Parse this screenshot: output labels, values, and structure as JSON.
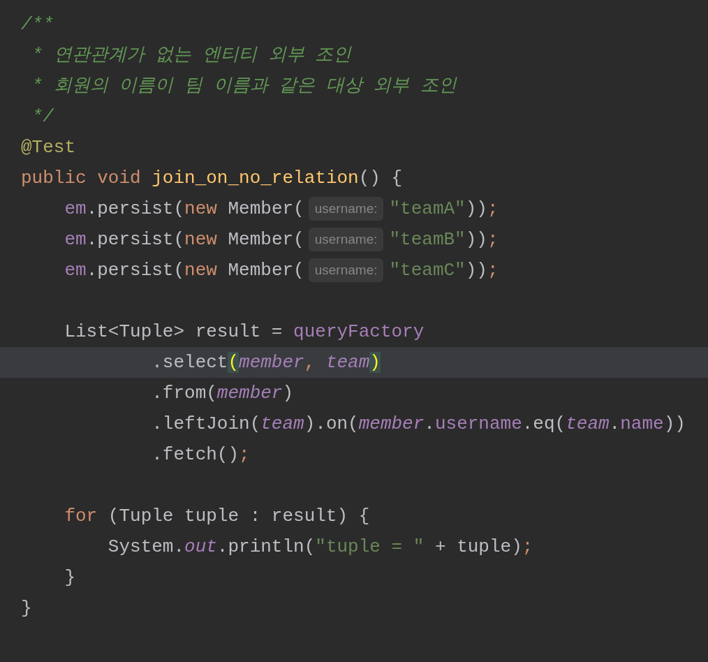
{
  "editor": {
    "lines": [
      {
        "current": false,
        "tokens": [
          {
            "kind": "comment",
            "text": "/**"
          }
        ]
      },
      {
        "current": false,
        "tokens": [
          {
            "kind": "comment",
            "text": " * 연관관계가 없는 엔티티 외부 조인"
          }
        ]
      },
      {
        "current": false,
        "tokens": [
          {
            "kind": "comment",
            "text": " * 회원의 이름이 팀 이름과 같은 대상 외부 조인"
          }
        ]
      },
      {
        "current": false,
        "tokens": [
          {
            "kind": "comment",
            "text": " */"
          }
        ]
      },
      {
        "current": false,
        "tokens": [
          {
            "kind": "annotation",
            "text": "@Test"
          }
        ]
      },
      {
        "current": false,
        "tokens": [
          {
            "kind": "keyword",
            "text": "public void "
          },
          {
            "kind": "method",
            "text": "join_on_no_relation"
          },
          {
            "kind": "plain",
            "text": "() {"
          }
        ]
      },
      {
        "current": false,
        "tokens": [
          {
            "kind": "field",
            "text": "    em"
          },
          {
            "kind": "plain",
            "text": ".persist("
          },
          {
            "kind": "keyword",
            "text": "new"
          },
          {
            "kind": "plain",
            "text": " Member("
          },
          {
            "kind": "hint",
            "text": "username:"
          },
          {
            "kind": "string",
            "text": "\"teamA\""
          },
          {
            "kind": "plain",
            "text": "))"
          },
          {
            "kind": "punct",
            "text": ";"
          }
        ]
      },
      {
        "current": false,
        "tokens": [
          {
            "kind": "field",
            "text": "    em"
          },
          {
            "kind": "plain",
            "text": ".persist("
          },
          {
            "kind": "keyword",
            "text": "new"
          },
          {
            "kind": "plain",
            "text": " Member("
          },
          {
            "kind": "hint",
            "text": "username:"
          },
          {
            "kind": "string",
            "text": "\"teamB\""
          },
          {
            "kind": "plain",
            "text": "))"
          },
          {
            "kind": "punct",
            "text": ";"
          }
        ]
      },
      {
        "current": false,
        "tokens": [
          {
            "kind": "field",
            "text": "    em"
          },
          {
            "kind": "plain",
            "text": ".persist("
          },
          {
            "kind": "keyword",
            "text": "new"
          },
          {
            "kind": "plain",
            "text": " Member("
          },
          {
            "kind": "hint",
            "text": "username:"
          },
          {
            "kind": "string",
            "text": "\"teamC\""
          },
          {
            "kind": "plain",
            "text": "))"
          },
          {
            "kind": "punct",
            "text": ";"
          }
        ]
      },
      {
        "current": false
      },
      {
        "current": false,
        "tokens": [
          {
            "kind": "plain",
            "text": "    List<Tuple> result = "
          },
          {
            "kind": "field",
            "text": "queryFactory"
          }
        ]
      },
      {
        "current": true,
        "tokens": [
          {
            "kind": "plain",
            "text": "            .select"
          },
          {
            "kind": "match",
            "text": "("
          },
          {
            "kind": "italic",
            "text": "member"
          },
          {
            "kind": "punct",
            "text": ", "
          },
          {
            "kind": "italic",
            "text": "team"
          },
          {
            "kind": "match",
            "text": ")"
          }
        ]
      },
      {
        "current": false,
        "tokens": [
          {
            "kind": "plain",
            "text": "            .from("
          },
          {
            "kind": "italic",
            "text": "member"
          },
          {
            "kind": "plain",
            "text": ")"
          }
        ]
      },
      {
        "current": false,
        "tokens": [
          {
            "kind": "plain",
            "text": "            .leftJoin("
          },
          {
            "kind": "italic",
            "text": "team"
          },
          {
            "kind": "plain",
            "text": ").on("
          },
          {
            "kind": "italic",
            "text": "member"
          },
          {
            "kind": "plain",
            "text": "."
          },
          {
            "kind": "field",
            "text": "username"
          },
          {
            "kind": "plain",
            "text": ".eq("
          },
          {
            "kind": "italic",
            "text": "team"
          },
          {
            "kind": "plain",
            "text": "."
          },
          {
            "kind": "field",
            "text": "name"
          },
          {
            "kind": "plain",
            "text": "))"
          }
        ]
      },
      {
        "current": false,
        "tokens": [
          {
            "kind": "plain",
            "text": "            .fetch()"
          },
          {
            "kind": "punct",
            "text": ";"
          }
        ]
      },
      {
        "current": false
      },
      {
        "current": false,
        "tokens": [
          {
            "kind": "keyword",
            "text": "    for"
          },
          {
            "kind": "plain",
            "text": " (Tuple tuple : result) {"
          }
        ]
      },
      {
        "current": false,
        "tokens": [
          {
            "kind": "plain",
            "text": "        System."
          },
          {
            "kind": "italic",
            "text": "out"
          },
          {
            "kind": "plain",
            "text": ".println("
          },
          {
            "kind": "string",
            "text": "\"tuple = \""
          },
          {
            "kind": "plain",
            "text": " + tuple)"
          },
          {
            "kind": "punct",
            "text": ";"
          }
        ]
      },
      {
        "current": false,
        "tokens": [
          {
            "kind": "plain",
            "text": "    }"
          }
        ]
      },
      {
        "current": false,
        "tokens": [
          {
            "kind": "plain",
            "text": "}"
          }
        ]
      }
    ]
  }
}
